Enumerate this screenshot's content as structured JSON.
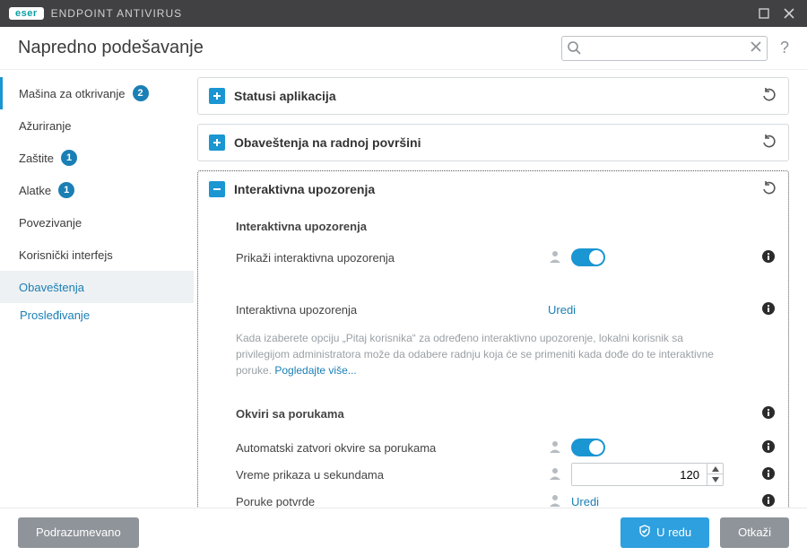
{
  "brand": {
    "logo": "eser",
    "product": "ENDPOINT ANTIVIRUS"
  },
  "header": {
    "title": "Napredno podešavanje",
    "search_placeholder": "",
    "help": "?"
  },
  "sidebar": {
    "items": [
      {
        "label": "Mašina za otkrivanje",
        "badge": "2",
        "active": true
      },
      {
        "label": "Ažuriranje"
      },
      {
        "label": "Zaštite",
        "badge": "1"
      },
      {
        "label": "Alatke",
        "badge": "1"
      },
      {
        "label": "Povezivanje"
      },
      {
        "label": "Korisnički interfejs"
      },
      {
        "label": "Obaveštenja",
        "selected": true
      }
    ],
    "children": [
      {
        "label": "Prosleđivanje"
      }
    ]
  },
  "panels": {
    "p0": {
      "title": "Statusi aplikacija"
    },
    "p1": {
      "title": "Obaveštenja na radnoj površini"
    },
    "p2": {
      "title": "Interaktivna upozorenja"
    }
  },
  "content": {
    "section1": "Interaktivna upozorenja",
    "row_show_alerts": "Prikaži interaktivna upozorenja",
    "row_edit_alerts_label": "Interaktivna upozorenja",
    "row_edit_alerts_link": "Uredi",
    "hint_text": "Kada izaberete opciju „Pitaj korisnika“ za određeno interaktivno upozorenje, lokalni korisnik sa privilegijom administratora može da odabere radnju koja će se primeniti kada dođe do te interaktivne poruke. ",
    "hint_link": "Pogledajte više...",
    "section2": "Okviri sa porukama",
    "row_autoclose": "Automatski zatvori okvire sa porukama",
    "row_time_label": "Vreme prikaza u sekundama",
    "row_time_value": "120",
    "row_confirm_label": "Poruke potvrde",
    "row_confirm_link": "Uredi"
  },
  "footer": {
    "default": "Podrazumevano",
    "ok": "U redu",
    "cancel": "Otkaži"
  }
}
